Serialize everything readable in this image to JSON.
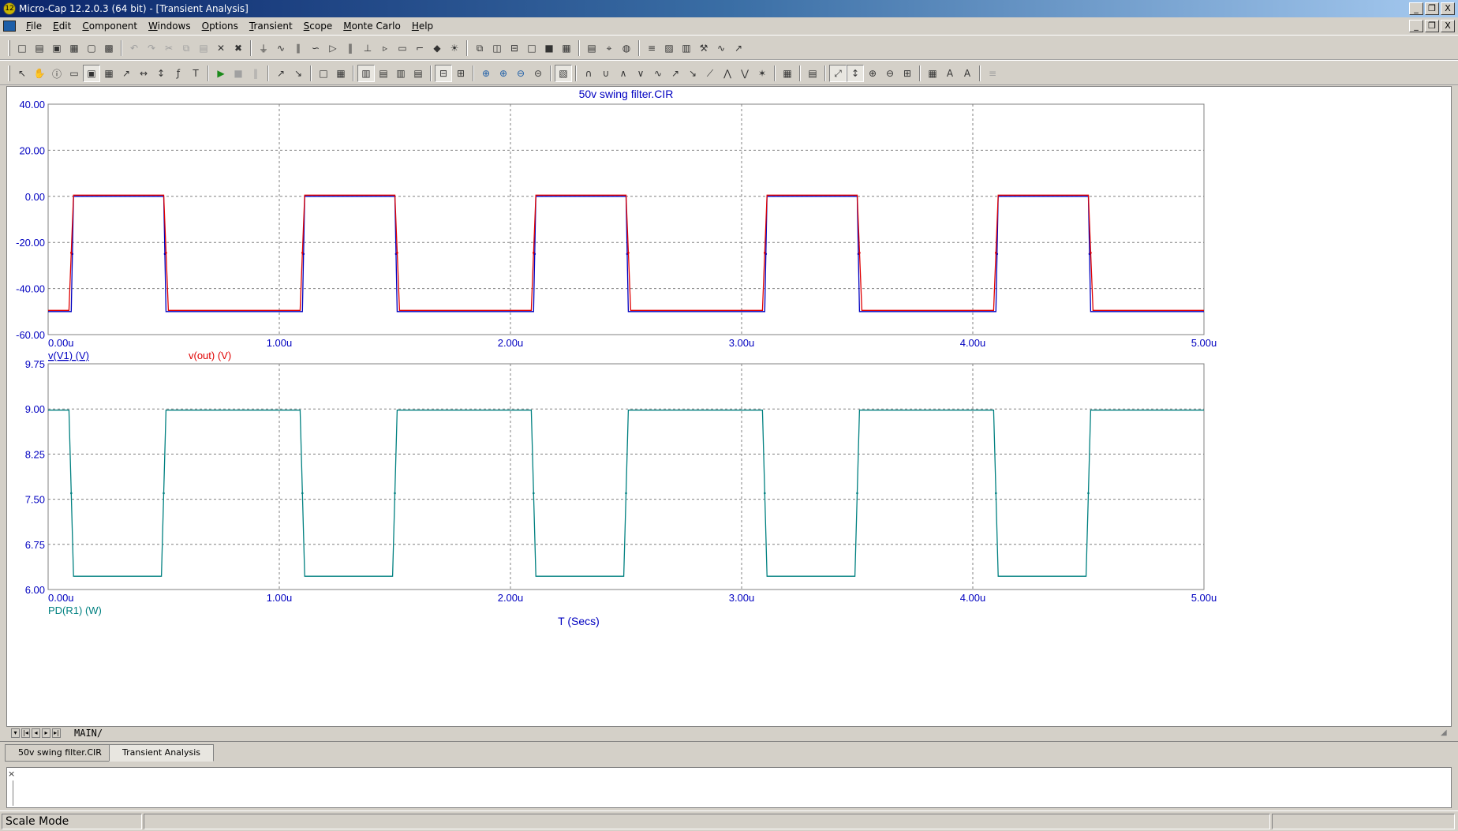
{
  "window": {
    "title": "Micro-Cap 12.2.0.3 (64 bit) - [Transient Analysis]",
    "app_icon": "micro-cap-logo-icon",
    "controls": [
      "_",
      "❐",
      "X"
    ],
    "mdi_controls": [
      "_",
      "❐",
      "X"
    ]
  },
  "menu": {
    "items": [
      {
        "accel": "F",
        "rest": "ile"
      },
      {
        "accel": "E",
        "rest": "dit"
      },
      {
        "accel": "C",
        "rest": "omponent"
      },
      {
        "accel": "W",
        "rest": "indows"
      },
      {
        "accel": "O",
        "rest": "ptions"
      },
      {
        "accel": "T",
        "rest": "ransient"
      },
      {
        "accel": "S",
        "rest": "cope"
      },
      {
        "accel": "M",
        "rest": "onte Carlo"
      },
      {
        "accel": "H",
        "rest": "elp"
      }
    ]
  },
  "toolbar1": {
    "icons": [
      "new-file-icon",
      "open-file-icon",
      "save-icon",
      "save-all-icon",
      "print-preview-icon",
      "print-icon",
      "|",
      "undo-icon",
      "redo-icon",
      "cut-icon",
      "copy-icon",
      "paste-icon",
      "clear-icon",
      "delete-icon",
      "|",
      "ground-icon",
      "resistor-icon",
      "capacitor-icon",
      "inductor-icon",
      "diode-icon",
      "battery-icon",
      "transistor-icon",
      "opamp-icon",
      "gate-icon",
      "switch-icon",
      "node-icon",
      "lamp-icon",
      "|",
      "cascade-icon",
      "tile-vertical-icon",
      "tile-horizontal-icon",
      "window-icon",
      "maximize-icon",
      "calculator-icon",
      "|",
      "notes-icon",
      "probe-icon",
      "globe-icon",
      "|",
      "stepping-icon",
      "output-icon",
      "analysis-limits-icon",
      "tools-icon",
      "plot-icon",
      "plot-properties-icon"
    ]
  },
  "toolbar2": {
    "icons": [
      "select-arrow-icon",
      "pan-icon",
      "info-icon",
      "scope-icon",
      "zoom-box-icon",
      "graph-mode-icon",
      "tag-icon",
      "horizontal-tag-icon",
      "vertical-tag-icon",
      "formula-icon",
      "text-icon",
      "|",
      "run-icon",
      "stop-icon",
      "pause-icon",
      "|",
      "cursor-icon",
      "cursor-off-icon",
      "|",
      "box-icon",
      "grid-icon",
      "|",
      "view1-icon",
      "view2-icon",
      "view3-icon",
      "view4-icon",
      "|",
      "split-horizontal-icon",
      "split-grid-icon",
      "|",
      "zoom-fit-icon",
      "zoom-in-icon",
      "zoom-out-icon",
      "zoom-back-icon",
      "|",
      "waveform-icon",
      "|",
      "peak-icon",
      "valley-icon",
      "high-icon",
      "low-icon",
      "inflection-icon",
      "rising-icon",
      "falling-icon",
      "slope-icon",
      "global-high-icon",
      "global-low-icon",
      "point-tag-icon",
      "|",
      "table-icon",
      "|",
      "schematic-icon",
      "|",
      "scale-fit-icon",
      "scale-y-icon",
      "zoom-in-2-icon",
      "zoom-out-2-icon",
      "zoom-region-icon",
      "|",
      "grid-layout-icon",
      "font-icon",
      "style-icon",
      "|",
      "align-icons"
    ]
  },
  "plot": {
    "title": "50v swing filter.CIR",
    "upper": {
      "y_ticks": [
        "40.00",
        "20.00",
        "0.00",
        "-20.00",
        "-40.00",
        "-60.00"
      ],
      "x_ticks": [
        "0.00u",
        "1.00u",
        "2.00u",
        "3.00u",
        "4.00u",
        "5.00u"
      ],
      "legend": [
        {
          "label": "v(V1) (V)",
          "color": "#0000c0"
        },
        {
          "label": "v(out) (V)",
          "color": "#e00000"
        }
      ]
    },
    "lower": {
      "y_ticks": [
        "9.75",
        "9.00",
        "8.25",
        "7.50",
        "6.75",
        "6.00"
      ],
      "x_ticks": [
        "0.00u",
        "1.00u",
        "2.00u",
        "3.00u",
        "4.00u",
        "5.00u"
      ],
      "legend": [
        {
          "label": "PD(R1) (W)",
          "color": "#008080"
        }
      ],
      "xlabel": "T (Secs)"
    },
    "axis_text_color": "#0000c0",
    "grid_color": "#808080"
  },
  "chart_data": [
    {
      "type": "line",
      "title": "50v swing filter.CIR",
      "xlabel": "",
      "ylabel": "",
      "xlim": [
        0,
        5.0
      ],
      "ylim": [
        -60,
        40
      ],
      "x_unit": "u",
      "grid": true,
      "series": [
        {
          "name": "v(V1) (V)",
          "color": "#0000c0",
          "x": [
            0,
            0.1,
            0.11,
            0.5,
            0.51,
            1.1,
            1.11,
            1.5,
            1.51,
            2.1,
            2.11,
            2.5,
            2.51,
            3.1,
            3.11,
            3.5,
            3.51,
            4.1,
            4.11,
            4.5,
            4.51,
            5.0
          ],
          "values": [
            -50,
            -50,
            0,
            0,
            -50,
            -50,
            0,
            0,
            -50,
            -50,
            0,
            0,
            -50,
            -50,
            0,
            0,
            -50,
            -50,
            0,
            0,
            -50,
            -50
          ]
        },
        {
          "name": "v(out) (V)",
          "color": "#e00000",
          "x": [
            0,
            0.09,
            0.11,
            0.5,
            0.52,
            1.09,
            1.11,
            1.5,
            1.52,
            2.09,
            2.11,
            2.5,
            2.52,
            3.09,
            3.11,
            3.5,
            3.52,
            4.09,
            4.11,
            4.5,
            4.52,
            5.0
          ],
          "values": [
            -49.5,
            -49.5,
            0.5,
            0.5,
            -49.5,
            -49.5,
            0.5,
            0.5,
            -49.5,
            -49.5,
            0.5,
            0.5,
            -49.5,
            -49.5,
            0.5,
            0.5,
            -49.5,
            -49.5,
            0.5,
            0.5,
            -49.5,
            -49.5
          ]
        }
      ]
    },
    {
      "type": "line",
      "title": "",
      "xlabel": "T (Secs)",
      "ylabel": "",
      "xlim": [
        0,
        5.0
      ],
      "ylim": [
        6.0,
        9.75
      ],
      "x_unit": "u",
      "grid": true,
      "series": [
        {
          "name": "PD(R1) (W)",
          "color": "#008080",
          "x": [
            0,
            0.09,
            0.11,
            0.49,
            0.51,
            1.09,
            1.11,
            1.49,
            1.51,
            2.09,
            2.11,
            2.49,
            2.51,
            3.09,
            3.11,
            3.49,
            3.51,
            4.09,
            4.11,
            4.49,
            4.51,
            5.0
          ],
          "values": [
            8.98,
            8.98,
            6.22,
            6.22,
            8.98,
            8.98,
            6.22,
            6.22,
            8.98,
            8.98,
            6.22,
            6.22,
            8.98,
            8.98,
            6.22,
            6.22,
            8.98,
            8.98,
            6.22,
            6.22,
            8.98,
            8.98
          ]
        }
      ]
    }
  ],
  "sheet": {
    "tab_label": "MAIN/",
    "nav": [
      "▾",
      "|◂",
      "◂",
      "▸",
      "▸|"
    ]
  },
  "doc_tabs": [
    {
      "label": "50v swing filter.CIR",
      "active": false
    },
    {
      "label": "Transient Analysis",
      "active": true
    }
  ],
  "output": {
    "close": "×"
  },
  "status": {
    "mode": "Scale Mode"
  }
}
